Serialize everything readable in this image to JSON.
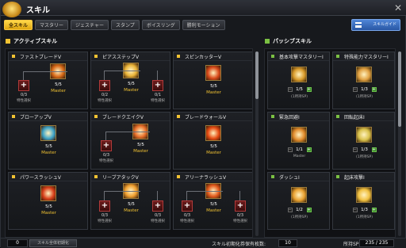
{
  "window": {
    "title": "スキル",
    "close_glyph": "✕"
  },
  "tabs": [
    "全スキル",
    "マスタリー",
    "ジェスチャー",
    "スタンプ",
    "ボイスリング",
    "勝利モーション"
  ],
  "guide_button": {
    "label": "スキルガイド"
  },
  "sections": {
    "active_title": "アクティブスキル",
    "passive_title": "パッシブスキル"
  },
  "active_cards": [
    {
      "name": "ファストブレードV",
      "level": "5/5",
      "mastery": "Master",
      "subs": [
        {
          "value": "0/3",
          "note": "特性選択"
        }
      ],
      "icon_color": "#d86a18"
    },
    {
      "name": "ピアスステップV",
      "level": "5/5",
      "mastery": "Master",
      "subs": [
        {
          "value": "0/2",
          "note": "特性選択"
        },
        {
          "value": "0/1",
          "note": "特性選択"
        }
      ],
      "icon_color": "#e9b338"
    },
    {
      "name": "スピンカッターV",
      "level": "5/5",
      "mastery": "Master",
      "subs": [],
      "icon_color": "#d94a1a"
    },
    {
      "name": "ブローアップV",
      "level": "5/5",
      "mastery": "Master",
      "subs": [],
      "icon_color": "#3ea3c6"
    },
    {
      "name": "ブレードクエイクV",
      "level": "5/5",
      "mastery": "Master",
      "subs": [
        {
          "value": "0/3",
          "note": "特性選択"
        }
      ],
      "icon_color": "#e8702a"
    },
    {
      "name": "ブレードウォールV",
      "level": "5/5",
      "mastery": "Master",
      "subs": [],
      "icon_color": "#e64b12"
    },
    {
      "name": "パワースラッシュV",
      "level": "5/5",
      "mastery": "Master",
      "subs": [],
      "icon_color": "#d8401a"
    },
    {
      "name": "リーブアタックV",
      "level": "5/5",
      "mastery": "Master",
      "subs": [
        {
          "value": "0/3",
          "note": "特性選択"
        },
        {
          "value": "0/3",
          "note": "特性選択"
        }
      ],
      "icon_color": "#f0a030"
    },
    {
      "name": "アリーナラッシュV",
      "level": "5/5",
      "mastery": "Master",
      "subs": [
        {
          "value": "0/3",
          "note": "特性選択"
        },
        {
          "value": "0/3",
          "note": "特性選択"
        }
      ],
      "icon_color": "#e25a1c"
    }
  ],
  "passive_cards": [
    {
      "name": "基本攻撃マスタリーI",
      "value": "1/5",
      "note": "(1所持SP)",
      "icon_color": "#d89a2a"
    },
    {
      "name": "特殊能力マスタリーI",
      "value": "1/3",
      "note": "(1所持SP)",
      "icon_color": "#e0a040"
    },
    {
      "name": "緊急回避I",
      "value": "1/1",
      "note": "Master",
      "icon_color": "#e08a2a"
    },
    {
      "name": "回転起床I",
      "value": "1/3",
      "note": "(1所持SP)",
      "icon_color": "#d8c04a"
    },
    {
      "name": "ダッシュI",
      "value": "1/2",
      "note": "(1所持SP)",
      "icon_color": "#e8a030"
    },
    {
      "name": "起床攻撃I",
      "value": "1/3",
      "note": "(1所持SP)",
      "icon_color": "#f0c040"
    }
  ],
  "footer": {
    "reset_count": "0",
    "reset_button": "スキル全体初期化",
    "reset_label": "スキル初期化券保有枚数:",
    "reset_value": "10",
    "sp_label": "所持SP",
    "sp_value": "235 / 235"
  },
  "colors": {
    "accent_gold": "#f1c232",
    "passive_green": "#7bc043",
    "guide_blue": "#3a6fc0"
  }
}
